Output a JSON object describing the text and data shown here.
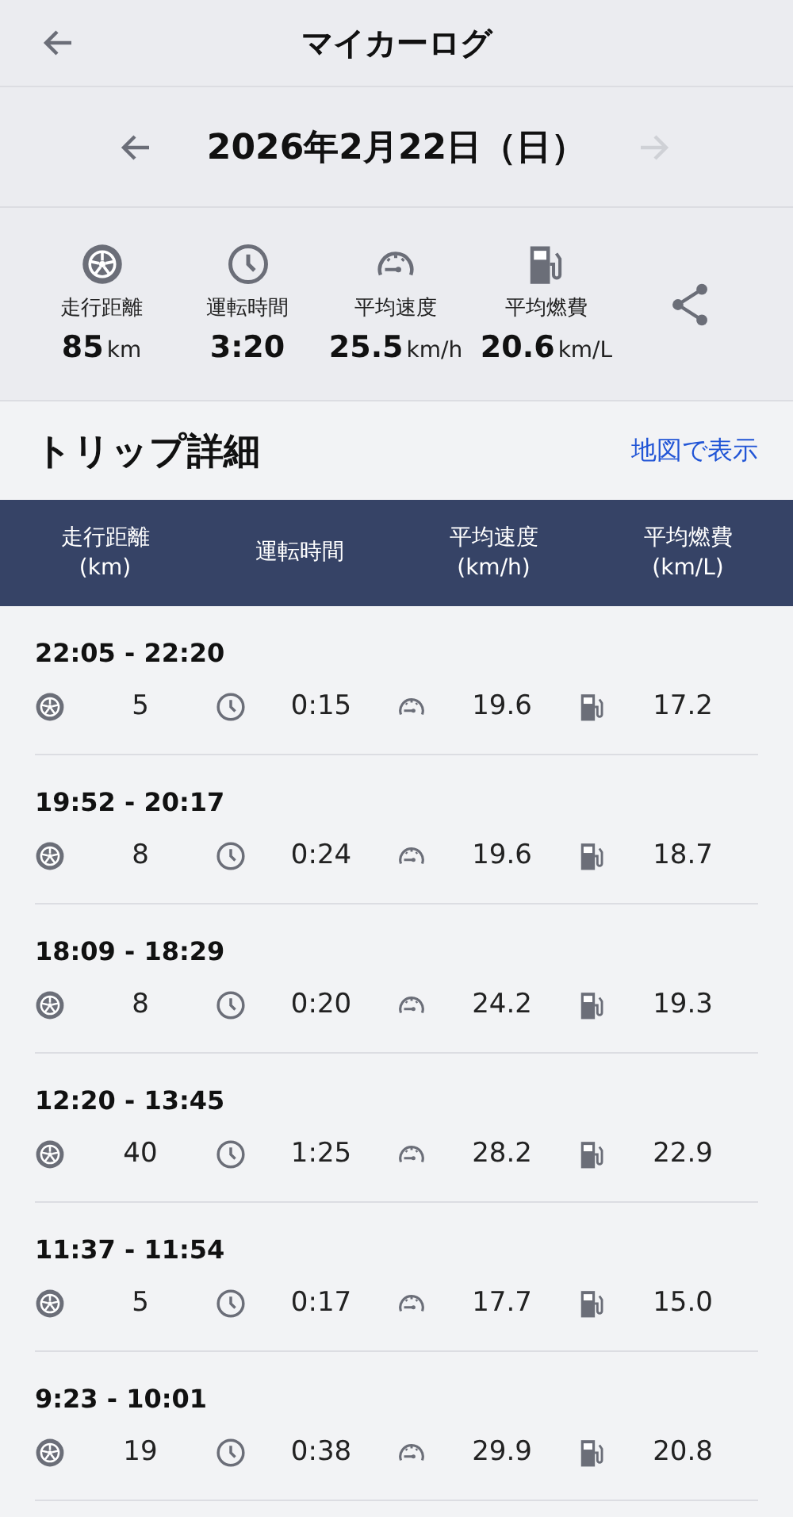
{
  "app_bar": {
    "title": "マイカーログ"
  },
  "date_nav": {
    "date": "2026年2月22日（日）",
    "prev_disabled": false,
    "next_disabled": true
  },
  "summary": [
    {
      "kind": "distance",
      "label": "走行距離",
      "value": "85",
      "unit": "km"
    },
    {
      "kind": "time",
      "label": "運転時間",
      "value": "3:20"
    },
    {
      "kind": "speed",
      "label": "平均速度",
      "value": "25.5",
      "unit": "km/h"
    },
    {
      "kind": "fuel",
      "label": "平均燃費",
      "value": "20.6",
      "unit": "km/L"
    }
  ],
  "section": {
    "title": "トリップ詳細",
    "link": "地図で表示"
  },
  "table": {
    "columns": [
      [
        "走行距離",
        "(km)"
      ],
      [
        "運転時間"
      ],
      [
        "平均速度",
        "(km/h)"
      ],
      [
        "平均燃費",
        "(km/L)"
      ]
    ],
    "trips": [
      {
        "time": "22:05 - 22:20",
        "values": [
          "5",
          "0:15",
          "19.6",
          "17.2"
        ]
      },
      {
        "time": "19:52 - 20:17",
        "values": [
          "8",
          "0:24",
          "19.6",
          "18.7"
        ]
      },
      {
        "time": "18:09 - 18:29",
        "values": [
          "8",
          "0:20",
          "24.2",
          "19.3"
        ]
      },
      {
        "time": "12:20 - 13:45",
        "values": [
          "40",
          "1:25",
          "28.2",
          "22.9"
        ]
      },
      {
        "time": "11:37 - 11:54",
        "values": [
          "5",
          "0:17",
          "17.7",
          "15.0"
        ]
      },
      {
        "time": "9:23 - 10:01",
        "values": [
          "19",
          "0:38",
          "29.9",
          "20.8"
        ]
      }
    ]
  }
}
